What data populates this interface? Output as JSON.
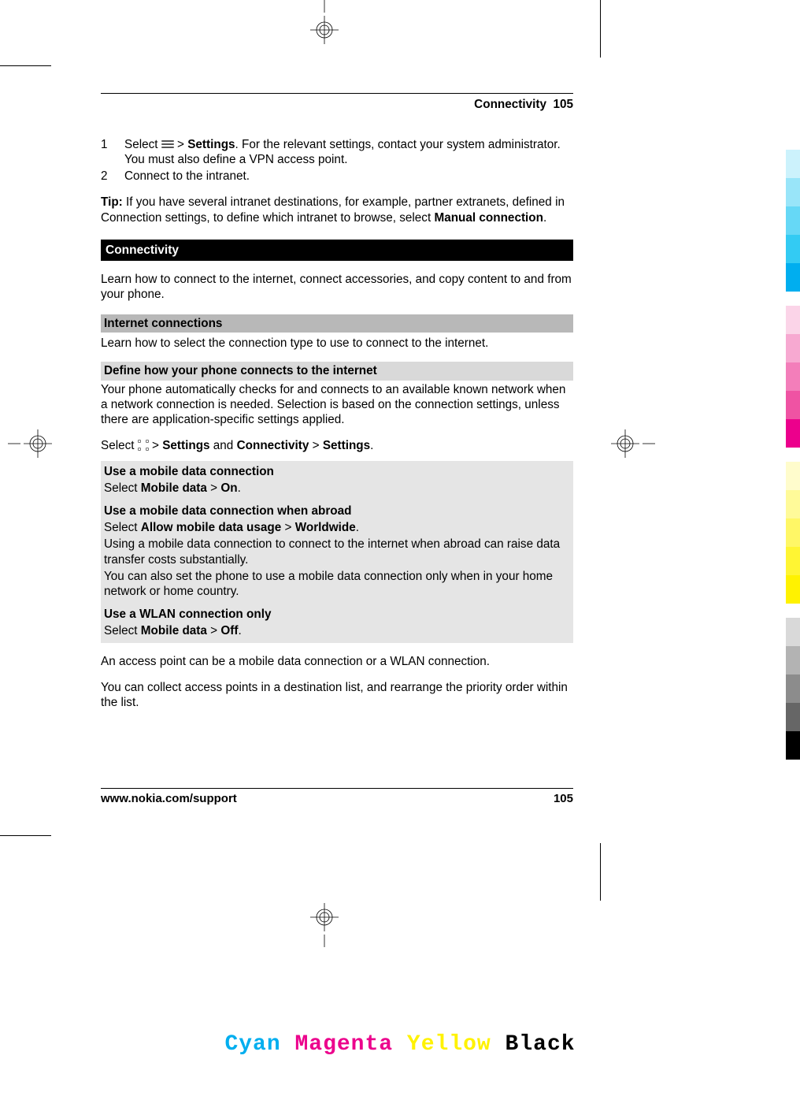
{
  "header": {
    "section": "Connectivity",
    "page": "105"
  },
  "steps": {
    "s1num": "1",
    "s1a": "Select ",
    "s1b": " > ",
    "s1c": "Settings",
    "s1d": ". For the relevant settings, contact your system administrator. You must also define a VPN access point.",
    "s2num": "2",
    "s2": "Connect to the intranet."
  },
  "tip": {
    "lbl": "Tip:",
    "a": " If you have several intranet destinations, for example, partner extranets, defined in Connection settings, to define which intranet to browse, select ",
    "b": "Manual connection",
    "c": "."
  },
  "connectivity": {
    "title": "Connectivity",
    "intro": "Learn how to connect to the internet, connect accessories, and copy content to and from your phone."
  },
  "internet": {
    "title": "Internet connections",
    "intro": "Learn how to select the connection type to use to connect to the internet."
  },
  "define": {
    "title": "Define how your phone connects to the internet",
    "p": "Your phone automatically checks for and connects to an available known network when a network connection is needed. Selection is based on the connection settings, unless there are application-specific settings applied.",
    "sel_a": "Select ",
    "sel_b": " > ",
    "sel_c": "Settings",
    "sel_d": " and ",
    "sel_e": "Connectivity",
    "sel_f": " > ",
    "sel_g": "Settings",
    "sel_h": "."
  },
  "box1": {
    "h": "Use a mobile data connection",
    "a": "Select ",
    "b": "Mobile data",
    "c": " > ",
    "d": "On",
    "e": "."
  },
  "box2": {
    "h": "Use a mobile data connection when abroad",
    "a": "Select ",
    "b": "Allow mobile data usage",
    "c": " > ",
    "d": "Worldwide",
    "e": ".",
    "p2": "Using a mobile data connection to connect to the internet when abroad can raise data transfer costs substantially.",
    "p3": "You can also set the phone to use a mobile data connection only when in your home network or home country."
  },
  "box3": {
    "h": "Use a WLAN connection only",
    "a": "Select ",
    "b": "Mobile data",
    "c": " > ",
    "d": "Off",
    "e": "."
  },
  "after": {
    "p1": "An access point can be a mobile data connection or a WLAN connection.",
    "p2": "You can collect access points in a destination list, and rearrange the priority order within the list."
  },
  "footer": {
    "url": "www.nokia.com/support",
    "page": "105"
  },
  "colors": {
    "c": "Cyan",
    "m": "Magenta",
    "y": "Yellow",
    "k": "Black"
  },
  "swatch_colors": {
    "c": [
      "#ccf2fc",
      "#99e5f9",
      "#66d8f6",
      "#33cbf3",
      "#00aeef"
    ],
    "m": [
      "#fbd4e8",
      "#f7a9d1",
      "#f37eba",
      "#ef53a3",
      "#ec008c"
    ],
    "y": [
      "#fffccc",
      "#fffa99",
      "#fff766",
      "#fff533",
      "#fff200"
    ],
    "k": [
      "#d9d9d9",
      "#b3b3b3",
      "#8c8c8c",
      "#666666",
      "#000000"
    ]
  }
}
